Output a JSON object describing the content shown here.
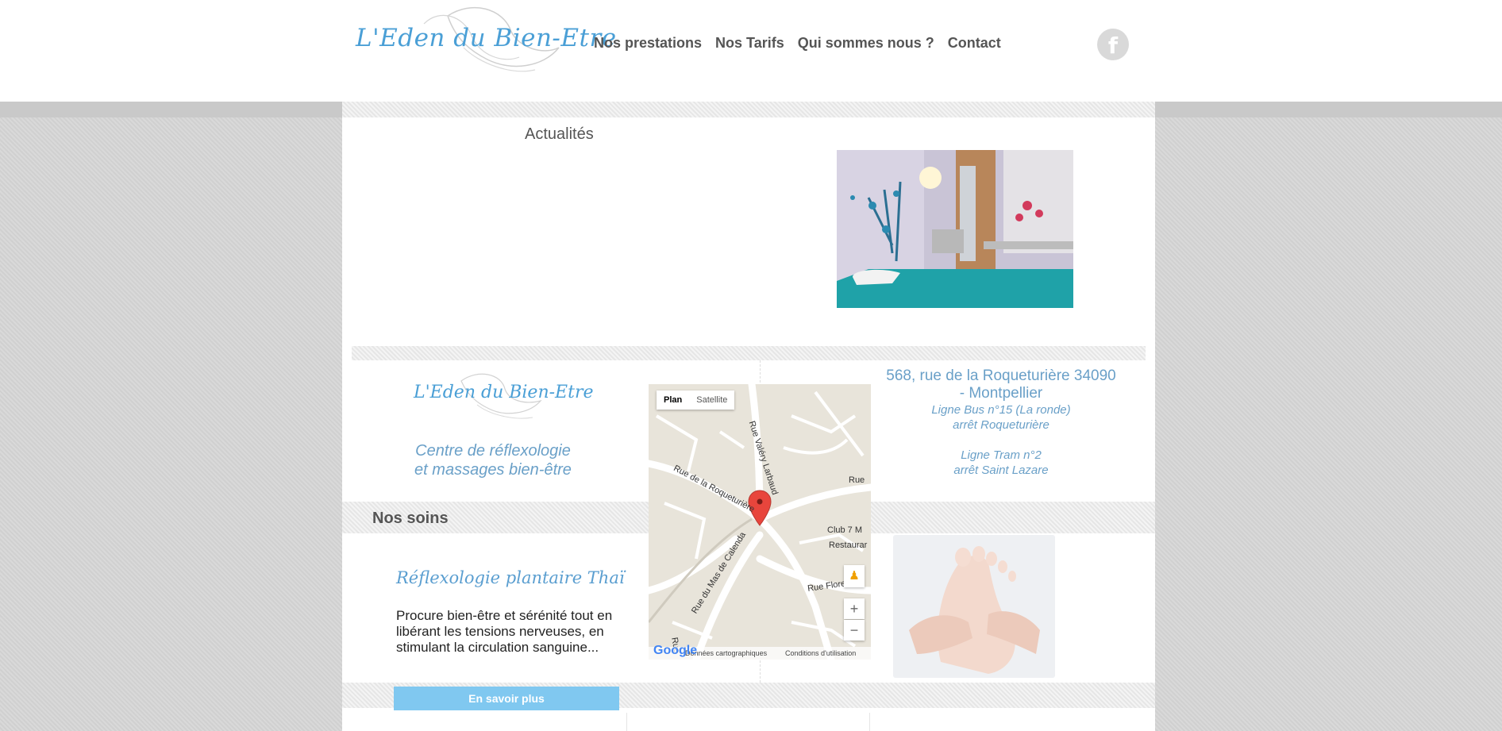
{
  "header": {
    "logo_text": "L'Eden du Bien-Etre",
    "nav": [
      "Nos prestations",
      "Nos Tarifs",
      "Qui sommes nous ?",
      "Contact"
    ],
    "social_icon": "facebook-icon"
  },
  "news": {
    "title": "Actualités"
  },
  "info": {
    "logo_text": "L'Eden du Bien-Etre",
    "tagline_1": "Centre de réflexologie",
    "tagline_2": "et massages bien-être",
    "address_1": "568, rue de la Roqueturière 34090",
    "address_2": "- Montpellier",
    "bus_1": "Ligne Bus n°15 (La ronde)",
    "bus_2": "arrêt Roqueturière",
    "tram_1": "Ligne Tram n°2",
    "tram_2": "arrêt Saint Lazare"
  },
  "map": {
    "tab_plan": "Plan",
    "tab_satellite": "Satellite",
    "zoom_in": "+",
    "zoom_out": "−",
    "street_1": "Rue Valéry Larbaud",
    "street_2": "Rue de la Roqueturière",
    "street_3": "Rue du Mas de Calenda",
    "street_4": "Rue Floreal",
    "poi_1": "Club 7 M",
    "poi_2": "Restaurar",
    "street_5": "Rue",
    "street_6": "Rue",
    "google": "Google",
    "data_label": "Données cartographiques",
    "terms_label": "Conditions d'utilisation"
  },
  "soins": {
    "title": "Nos soins",
    "item_name": "Réflexologie plantaire Thaï",
    "item_desc": "Procure bien-être et sérénité tout en libérant les tensions nerveuses, en stimulant la circulation sanguine...",
    "button": "En savoir plus"
  },
  "colors": {
    "accent_blue": "#4a9fd6",
    "button_blue": "#80c8f0",
    "text_gray": "#555555"
  }
}
